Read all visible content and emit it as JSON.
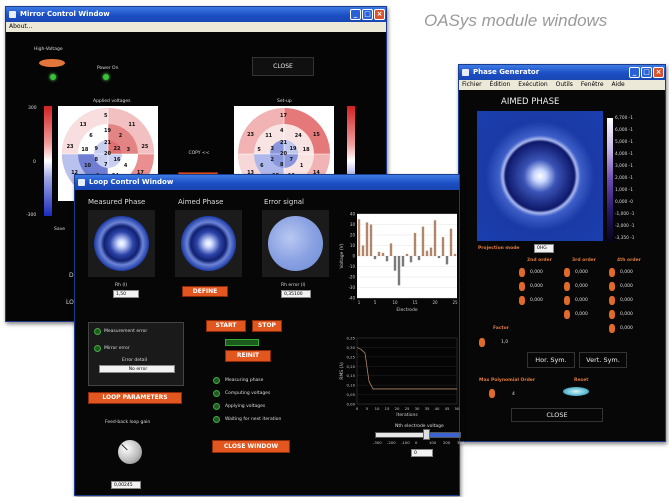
{
  "caption": "OASys module windows",
  "mirror": {
    "title": "Mirror Control Window",
    "menu": "About...",
    "high_voltage": "High-Voltage",
    "power_on": "Power On",
    "close": "CLOSE",
    "applied_voltages": "Applied voltages",
    "set_up": "Set-up",
    "copy": "COPY <<",
    "scale_top": "300",
    "scale_mid": "0",
    "scale_bot": "-300",
    "save_label": "Save",
    "de_label": "DE",
    "loo_label": "LOO",
    "ring_numbers": [
      "20",
      "21",
      "22",
      "16",
      "7",
      "8",
      "9",
      "19",
      "2",
      "3",
      "4",
      "24",
      "1",
      "10",
      "18",
      "6",
      "5",
      "11",
      "25",
      "17",
      "15",
      "14",
      "12",
      "23",
      "13"
    ],
    "ring_numbers_right": [
      "20",
      "21",
      "19",
      "7",
      "8",
      "2",
      "3",
      "4",
      "24",
      "18",
      "1",
      "10",
      "25",
      "6",
      "5",
      "11",
      "17",
      "15",
      "14",
      "12",
      "13",
      "23"
    ]
  },
  "loop": {
    "title": "Loop Control Window",
    "measured": "Measured Phase",
    "aimed": "Aimed Phase",
    "error": "Error signal",
    "rh_label": "Rh (l)",
    "rh_value": "1,50",
    "rh_error_label": "Rh error (l)",
    "rh_error_value": "0,35100",
    "define": "DEFINE",
    "start": "START",
    "stop": "STOP",
    "reinit": "REINIT",
    "measurement_error": "Measurement error",
    "mirror_error": "Mirror error",
    "error_detail": "Error detail",
    "error_value": "No error",
    "loop_params": "LOOP PARAMETERS",
    "gain_label": "Feed-back loop gain",
    "gain_value": "0,00245",
    "steps": [
      "Measuring phase",
      "Computing voltages",
      "Applying voltages",
      "Waiting for next iteration"
    ],
    "close_window": "CLOSE WINDOW",
    "bar_ylabel": "Voltage (V)",
    "bar_xlabel": "Electrode",
    "rms_ylabel": "RMS (λ)",
    "rms_xlabel": "Iterations",
    "slider_label": "Nth electrode voltage",
    "slider_value": "0",
    "bar_yticks": [
      "40",
      "30",
      "20",
      "10",
      "0",
      "-10",
      "-20",
      "-30",
      "-40"
    ],
    "bar_xticks": [
      "1",
      "5",
      "10",
      "15",
      "20",
      "25"
    ],
    "rms_yticks": [
      "0,35",
      "0,30",
      "0,25",
      "0,20",
      "0,15",
      "0,10",
      "0,05",
      "0,00"
    ],
    "rms_xticks": [
      "0",
      "5",
      "10",
      "15",
      "20",
      "25",
      "30",
      "35",
      "40",
      "45",
      "50"
    ],
    "slider_ticks": [
      "-300",
      "-200",
      "-100",
      "0",
      "100",
      "200",
      "300"
    ]
  },
  "phase": {
    "title": "Phase Generator",
    "menu": [
      "Fichier",
      "Édition",
      "Exécution",
      "Outils",
      "Fenêtre",
      "Aide"
    ],
    "aimed": "AIMED PHASE",
    "scale": [
      "6,700 -1",
      "6,000 -1",
      "5,000 -1",
      "4,000 -1",
      "3,000 -1",
      "2,000 -1",
      "1,000 -1",
      "0,000 -0",
      "-1,000 -1",
      "-2,000 -1",
      "-3,350 -1"
    ],
    "projection_mode": "Projection mode",
    "projection_value": "0HG",
    "order2": "2nd order",
    "order3": "3rd order",
    "order4": "4th order",
    "zero": "0,000",
    "factor": "Factor",
    "factor_value": "1,0",
    "hor_sym": "Hor. Sym.",
    "vert_sym": "Vert. Sym.",
    "max_order": "Max Polynomial Order",
    "max_order_value": "4",
    "reset": "Reset",
    "close": "CLOSE"
  },
  "chart_data": {
    "type": "bar",
    "ylabel": "Voltage (V)",
    "xlabel": "Electrode",
    "ylim": [
      -40,
      40
    ],
    "categories": [
      "1",
      "2",
      "3",
      "4",
      "5",
      "6",
      "7",
      "8",
      "9",
      "10",
      "11",
      "12",
      "13",
      "14",
      "15",
      "16",
      "17",
      "18",
      "19",
      "20",
      "21",
      "22",
      "23",
      "24",
      "25"
    ],
    "values": [
      35,
      10,
      32,
      30,
      -3,
      4,
      3,
      -5,
      12,
      -14,
      -28,
      -10,
      2,
      -6,
      22,
      -4,
      28,
      5,
      8,
      34,
      -2,
      18,
      -8,
      26,
      2
    ]
  }
}
